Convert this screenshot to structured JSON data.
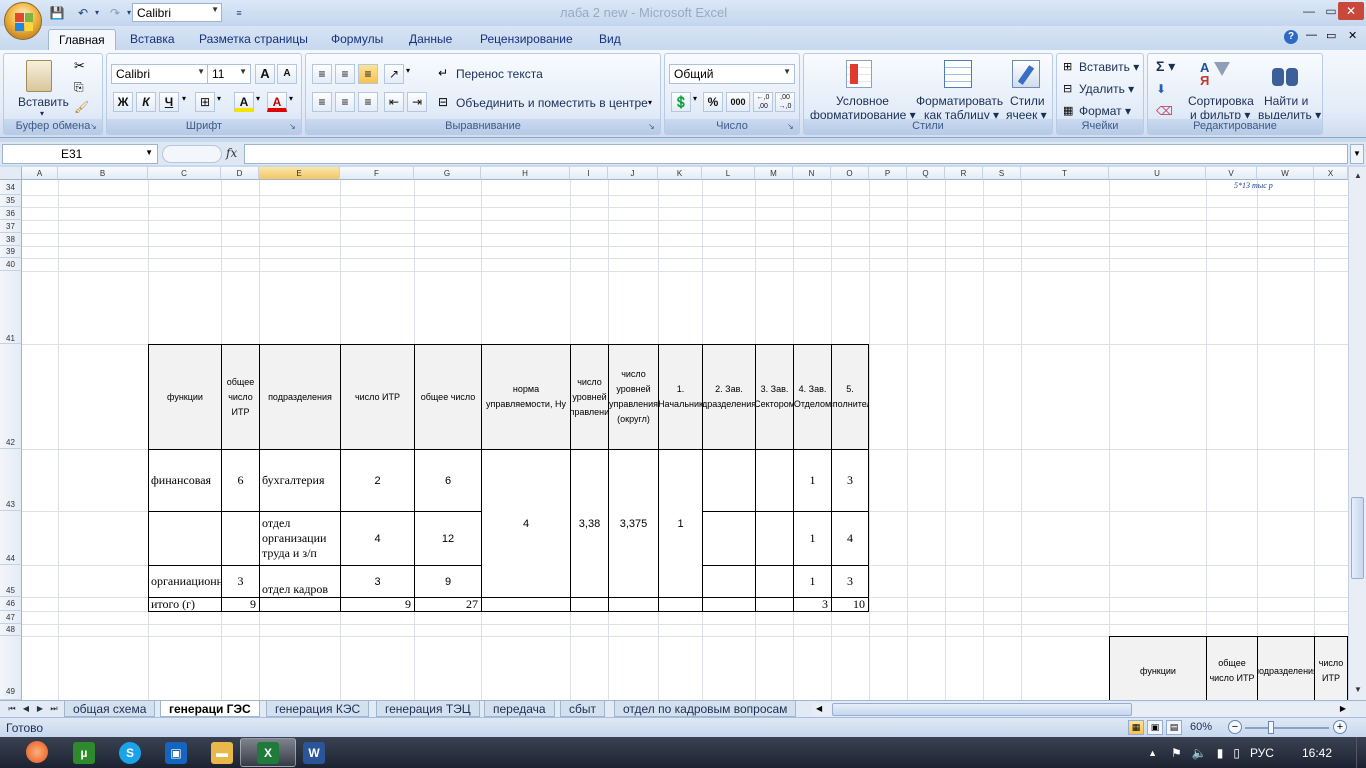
{
  "window": {
    "title": "лаба 2 new - Microsoft Excel",
    "qat_font": "Calibri",
    "help_icon": "?",
    "controls": [
      "—",
      "▭",
      "✕"
    ]
  },
  "ribbon_tabs": [
    "Главная",
    "Вставка",
    "Разметка страницы",
    "Формулы",
    "Данные",
    "Рецензирование",
    "Вид"
  ],
  "ribbon": {
    "clipboard": {
      "label": "Буфер обмена",
      "paste": "Вставить"
    },
    "font": {
      "label": "Шрифт",
      "name": "Calibri",
      "size": "11",
      "bold": "Ж",
      "italic": "К",
      "underline": "Ч",
      "grow": "A",
      "shrink": "A",
      "fill": "A",
      "color": "A"
    },
    "alignment": {
      "label": "Выравнивание",
      "wrap": "Перенос текста",
      "merge": "Объединить и поместить в центре"
    },
    "number": {
      "label": "Число",
      "format": "Общий",
      "percent": "%",
      "thousands": "000",
      "inc": "←,0 ,00",
      "dec": ",00 →,0"
    },
    "styles": {
      "label": "Стили",
      "conditional_1": "Условное",
      "conditional_2": "форматирование ▾",
      "as_table_1": "Форматировать",
      "as_table_2": "как таблицу ▾",
      "cell_styles_1": "Стили",
      "cell_styles_2": "ячеек ▾"
    },
    "cells": {
      "label": "Ячейки",
      "insert": "Вставить ▾",
      "delete": "Удалить ▾",
      "format": "Формат ▾"
    },
    "editing": {
      "label": "Редактирование",
      "sigma": "Σ ▾",
      "sort_1": "Сортировка",
      "sort_2": "и фильтр ▾",
      "find_1": "Найти и",
      "find_2": "выделить ▾"
    }
  },
  "formula_bar": {
    "name_box": "E31",
    "fx": "fx",
    "formula": ""
  },
  "columns": [
    "A",
    "B",
    "C",
    "D",
    "E",
    "F",
    "G",
    "H",
    "I",
    "J",
    "K",
    "L",
    "M",
    "N",
    "O",
    "P",
    "Q",
    "R",
    "S",
    "T",
    "U",
    "V",
    "W",
    "X"
  ],
  "selected_column": "E",
  "rows": [
    "34",
    "35",
    "36",
    "37",
    "38",
    "39",
    "40",
    "41",
    "42",
    "43",
    "44",
    "45",
    "46",
    "47",
    "48",
    "49"
  ],
  "note": "5*13 тыс р",
  "table_headers": {
    "functions": "функции",
    "total_itr": "общее число ИТР",
    "departments": "подразделения",
    "itr_count": "число ИТР",
    "total_count": "общее число",
    "norm": "норма управляемости, Ну",
    "levels": "число уровней управления",
    "levels_round": "число уровней управления (округл)",
    "chief": "1. Начальник",
    "dept_heads": "2. Зав. Подразделениями",
    "sector_heads": "3. Зав. Сектором",
    "section_heads": "4. Зав. Отделом",
    "executors": "5. исполнители"
  },
  "table_rows": [
    {
      "function": "финансовая",
      "total_itr": "6",
      "department": "бухгалтерия",
      "itr": "2",
      "total": "6",
      "section": "1",
      "executors": "3"
    },
    {
      "function": "",
      "total_itr": "",
      "department": "отдел организации труда и з/п",
      "itr": "4",
      "total": "12",
      "section": "1",
      "executors": "4"
    },
    {
      "function": "органиационная",
      "total_itr": "3",
      "department": "отдел кадров",
      "itr": "3",
      "total": "9",
      "section": "1",
      "executors": "3"
    }
  ],
  "merged_values": {
    "norm": "4",
    "levels": "3,38",
    "levels_round": "3,375",
    "chief": "1"
  },
  "totals_row": {
    "label": "итого (г)",
    "total_itr": "9",
    "itr": "9",
    "total": "27",
    "section": "3",
    "executors": "10"
  },
  "second_table": {
    "functions": "функции",
    "total_itr": "общее число ИТР",
    "departments": "подразделения",
    "itr": "число ИТР"
  },
  "sheet_tabs": [
    "общая схема",
    "генераци ГЭС",
    "генерация КЭС",
    "генерация ТЭЦ",
    "передача",
    "сбыт",
    "отдел по кадровым вопросам"
  ],
  "active_sheet": "генераци ГЭС",
  "status": {
    "ready": "Готово",
    "zoom": "60%"
  },
  "taskbar": {
    "apps": [
      "Opera",
      "uTorrent",
      "Skype",
      "Remote",
      "Explorer",
      "Excel",
      "Word"
    ],
    "language": "РУС",
    "time": "16:42"
  }
}
